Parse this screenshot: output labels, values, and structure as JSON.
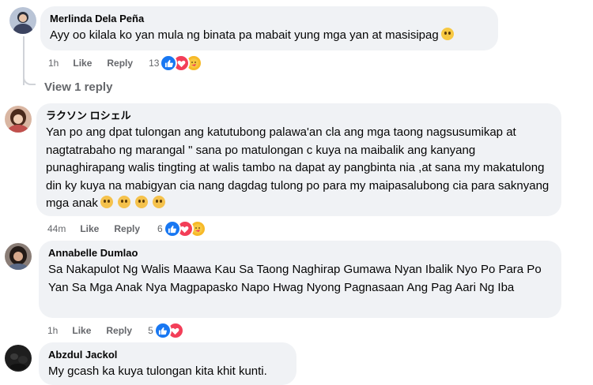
{
  "comments": [
    {
      "author": "Merlinda Dela Peña",
      "text": "Ayy oo kilala ko yan mula ng binata pa mabait yung mga yan at masisipag",
      "emoji": "slightly-smiling-face",
      "time": "1h",
      "like_label": "Like",
      "reply_label": "Reply",
      "reaction_count": "13",
      "reactions": [
        "like",
        "love",
        "care"
      ]
    },
    {
      "author": "ラクソン ロシェル",
      "text": "Yan po ang dpat tulongan ang katutubong palawa'an cla ang mga taong nagsusumikap at nagtatrabaho ng marangal \" sana po matulongan c kuya na maibalik ang kanyang punaghirapang walis tingting at walis tambo na dapat ay pangbinta nia ,at sana my makatulong din ky kuya na mabigyan cia nang dagdag tulong po para my maipasalubong cia para saknyang mga anak",
      "emoji": "pleading-face x4",
      "time": "44m",
      "like_label": "Like",
      "reply_label": "Reply",
      "reaction_count": "6",
      "reactions": [
        "like",
        "love",
        "care"
      ]
    },
    {
      "author": "Annabelle Dumlao",
      "text": "Sa Nakapulot Ng Walis Maawa Kau Sa Taong Naghirap Gumawa Nyan Ibalik Nyo Po Para Po Yan Sa Mga Anak Nya Magpapasko Napo Hwag Nyong Pagnasaan Ang Pag Aari Ng Iba",
      "time": "1h",
      "like_label": "Like",
      "reply_label": "Reply",
      "reaction_count": "5",
      "reactions": [
        "like",
        "love"
      ]
    },
    {
      "author": "Abzdul Jackol",
      "text": "My gcash ka kuya tulongan kita khit kunti."
    }
  ],
  "view_replies_label": "View 1 reply",
  "colors": {
    "bubble": "#f0f2f5",
    "meta": "#65676b",
    "like": "#1877f2",
    "love": "#f33e58",
    "care": "#f7b928"
  }
}
